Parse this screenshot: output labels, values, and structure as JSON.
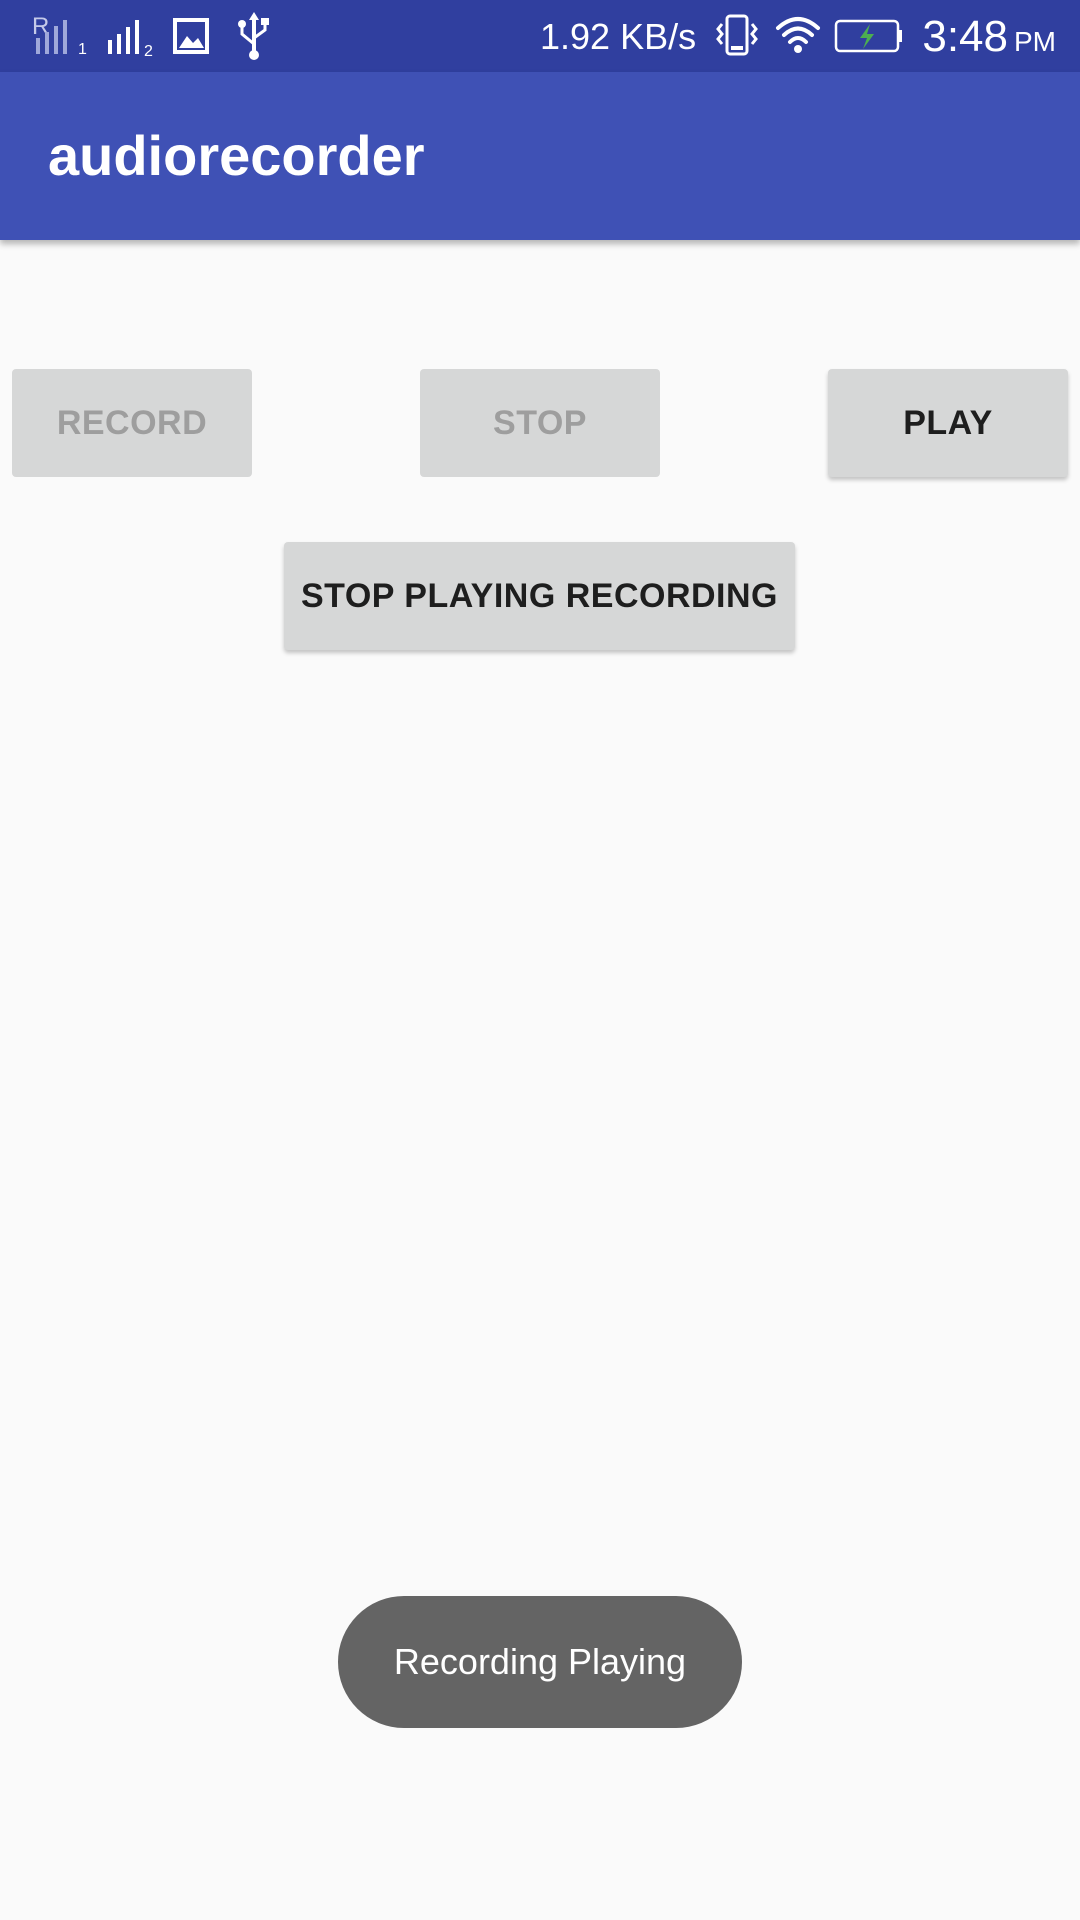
{
  "status_bar": {
    "sim1_label": "R",
    "sim1_index": "1",
    "sim2_index": "2",
    "net_speed": "1.92 KB/s",
    "time": "3:48",
    "ampm": "PM",
    "icons": [
      "signal-sim1-icon",
      "signal-sim2-icon",
      "gallery-icon",
      "usb-icon",
      "vibrate-icon",
      "wifi-icon",
      "battery-charging-icon"
    ],
    "colors": {
      "bar": "#303f9f",
      "battery_bolt": "#4caf50"
    }
  },
  "app_bar": {
    "title": "audiorecorder",
    "color": "#3f51b5"
  },
  "buttons": {
    "record": {
      "label": "RECORD",
      "enabled": false
    },
    "stop": {
      "label": "STOP",
      "enabled": false
    },
    "play": {
      "label": "PLAY",
      "enabled": true
    },
    "stop_playing": {
      "label": "STOP PLAYING RECORDING",
      "enabled": true
    }
  },
  "toast": {
    "message": "Recording Playing"
  }
}
